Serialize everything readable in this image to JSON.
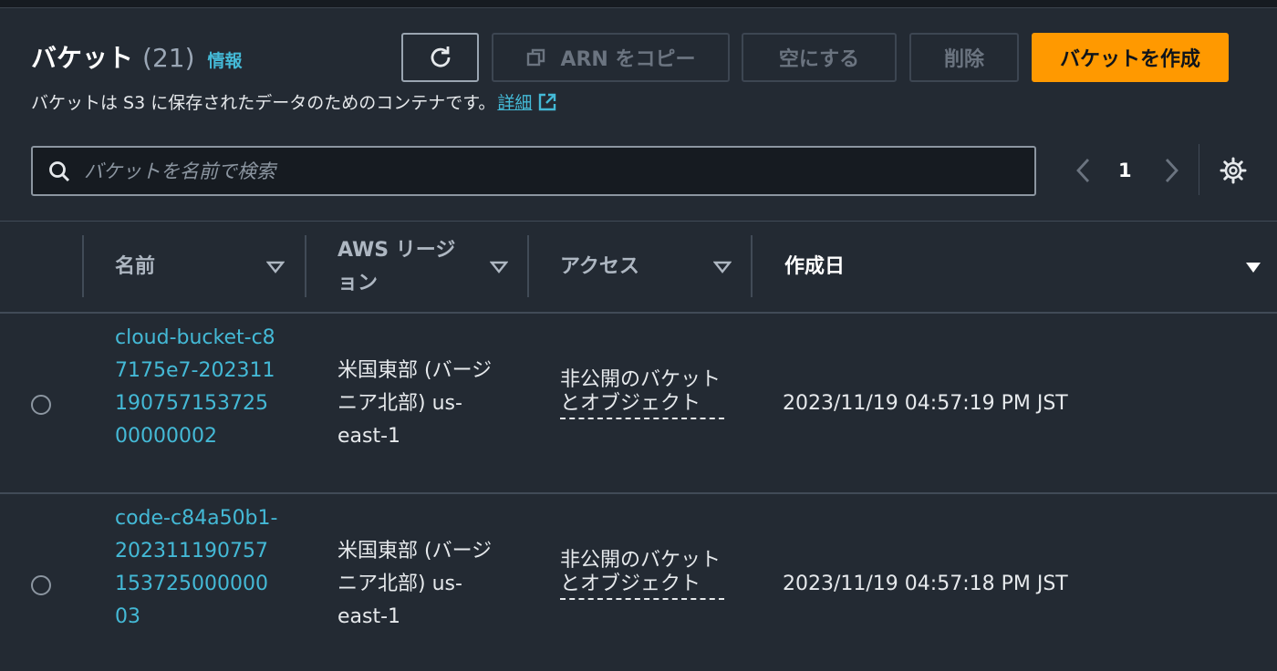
{
  "header": {
    "title": "バケット",
    "count": "(21)",
    "info": "情報",
    "description": "バケットは S3 に保存されたデータのためのコンテナです。",
    "details_link": "詳細"
  },
  "toolbar": {
    "copy_arn": "ARN をコピー",
    "empty": "空にする",
    "delete": "削除",
    "create": "バケットを作成"
  },
  "search": {
    "placeholder": "バケットを名前で検索"
  },
  "pagination": {
    "current_page": "1"
  },
  "table": {
    "columns": [
      "名前",
      "AWS リージョン",
      "アクセス",
      "作成日"
    ],
    "rows": [
      {
        "name": "cloud-bucket-c87175e7-20231119075715372500000002",
        "region": "米国東部 (バージニア北部) us-east-1",
        "access": "非公開のバケットとオブジェクト",
        "created": "2023/11/19 04:57:19 PM JST"
      },
      {
        "name": "code-c84a50b1-20231119075715372500000003",
        "region": "米国東部 (バージニア北部) us-east-1",
        "access": "非公開のバケットとオブジェクト",
        "created": "2023/11/19 04:57:18 PM JST"
      }
    ]
  },
  "colors": {
    "accent": "#ff9900",
    "link": "#44b9d6",
    "background": "#232a33"
  }
}
